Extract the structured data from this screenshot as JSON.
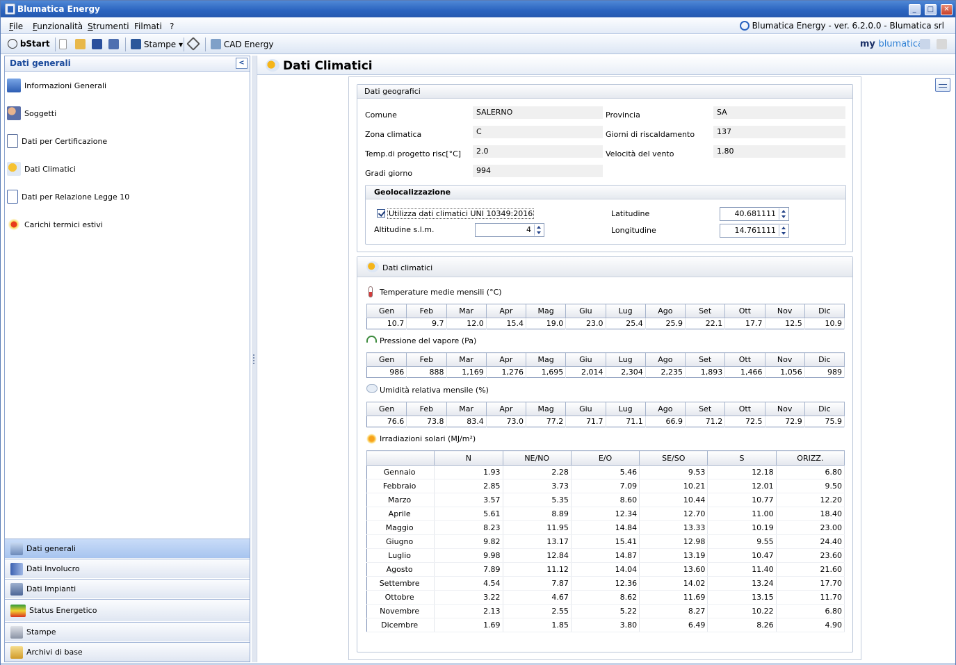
{
  "window": {
    "title": "Blumatica Energy"
  },
  "menu": {
    "items": [
      {
        "label": "File",
        "u": "F",
        "rest": "ile"
      },
      {
        "label": "Funzionalità",
        "u": "F",
        "rest": "unzionalità"
      },
      {
        "label": "Strumenti",
        "u": "S",
        "rest": "trumenti"
      },
      {
        "label": "Filmati",
        "u": "",
        "rest": "Filmati"
      },
      {
        "label": "?",
        "u": "",
        "rest": "?"
      }
    ],
    "version": "Blumatica Energy - ver. 6.2.0.0 - Blumatica srl"
  },
  "toolbar": {
    "bstart": "bStart",
    "stampe": "Stampe",
    "cad": "CAD Energy",
    "brand_my": "my",
    "brand_name": "blumatica"
  },
  "left": {
    "header": "Dati generali",
    "items": [
      {
        "label": "Informazioni Generali",
        "icon": "building-icon"
      },
      {
        "label": "Soggetti",
        "icon": "people-icon"
      },
      {
        "label": "Dati per Certificazione",
        "icon": "document-icon"
      },
      {
        "label": "Dati Climatici",
        "icon": "weather-icon"
      },
      {
        "label": "Dati per Relazione Legge 10",
        "icon": "report-icon"
      },
      {
        "label": "Carichi termici estivi",
        "icon": "thermometer-icon"
      }
    ],
    "tabs": [
      {
        "label": "Dati generali",
        "selected": true
      },
      {
        "label": "Dati Involucro"
      },
      {
        "label": "Dati Impianti"
      },
      {
        "label": "Status Energetico"
      },
      {
        "label": "Stampe"
      },
      {
        "label": "Archivi di base"
      }
    ]
  },
  "main": {
    "title": "Dati Climatici",
    "geo": {
      "header": "Dati geografici",
      "comune_label": "Comune",
      "comune": "SALERNO",
      "provincia_label": "Provincia",
      "provincia": "SA",
      "zona_label": "Zona climatica",
      "zona": "C",
      "giorni_label": "Giorni di riscaldamento",
      "giorni": "137",
      "temp_label": "Temp.di progetto risc[°C]",
      "temp": "2.0",
      "vento_label": "Velocità del vento",
      "vento": "1.80",
      "gradi_label": "Gradi giorno",
      "gradi": "994",
      "geoloc_header": "Geolocalizzazione",
      "uni_label": "Utilizza dati climatici UNI 10349:2016",
      "alt_label": "Altitudine s.l.m.",
      "alt": "4",
      "lat_label": "Latitudine",
      "lat": "40.681111",
      "lon_label": "Longitudine",
      "lon": "14.761111"
    },
    "clim": {
      "header": "Dati climatici",
      "months": [
        "Gen",
        "Feb",
        "Mar",
        "Apr",
        "Mag",
        "Giu",
        "Lug",
        "Ago",
        "Set",
        "Ott",
        "Nov",
        "Dic"
      ],
      "temp_label": "Temperature medie mensili (°C)",
      "temp": [
        "10.7",
        "9.7",
        "12.0",
        "15.4",
        "19.0",
        "23.0",
        "25.4",
        "25.9",
        "22.1",
        "17.7",
        "12.5",
        "10.9"
      ],
      "press_label": "Pressione del vapore (Pa)",
      "press": [
        "986",
        "888",
        "1,169",
        "1,276",
        "1,695",
        "2,014",
        "2,304",
        "2,235",
        "1,893",
        "1,466",
        "1,056",
        "989"
      ],
      "umid_label": "Umidità relativa mensile (%)",
      "umid": [
        "76.6",
        "73.8",
        "83.4",
        "73.0",
        "77.2",
        "71.7",
        "71.1",
        "66.9",
        "71.2",
        "72.5",
        "72.9",
        "75.9"
      ],
      "irr_label": "Irradiazioni solari (MJ/m²)",
      "irr_cols": [
        "",
        "N",
        "NE/NO",
        "E/O",
        "SE/SO",
        "S",
        "ORIZZ."
      ],
      "irr_rows": [
        [
          "Gennaio",
          "1.93",
          "2.28",
          "5.46",
          "9.53",
          "12.18",
          "6.80"
        ],
        [
          "Febbraio",
          "2.85",
          "3.73",
          "7.09",
          "10.21",
          "12.01",
          "9.50"
        ],
        [
          "Marzo",
          "3.57",
          "5.35",
          "8.60",
          "10.44",
          "10.77",
          "12.20"
        ],
        [
          "Aprile",
          "5.61",
          "8.89",
          "12.34",
          "12.70",
          "11.00",
          "18.40"
        ],
        [
          "Maggio",
          "8.23",
          "11.95",
          "14.84",
          "13.33",
          "10.19",
          "23.00"
        ],
        [
          "Giugno",
          "9.82",
          "13.17",
          "15.41",
          "12.98",
          "9.55",
          "24.40"
        ],
        [
          "Luglio",
          "9.98",
          "12.84",
          "14.87",
          "13.19",
          "10.47",
          "23.60"
        ],
        [
          "Agosto",
          "7.89",
          "11.12",
          "14.04",
          "13.60",
          "11.40",
          "21.60"
        ],
        [
          "Settembre",
          "4.54",
          "7.87",
          "12.36",
          "14.02",
          "13.24",
          "17.70"
        ],
        [
          "Ottobre",
          "3.22",
          "4.67",
          "8.62",
          "11.69",
          "13.15",
          "11.70"
        ],
        [
          "Novembre",
          "2.13",
          "2.55",
          "5.22",
          "8.27",
          "10.22",
          "6.80"
        ],
        [
          "Dicembre",
          "1.69",
          "1.85",
          "3.80",
          "6.49",
          "8.26",
          "4.90"
        ]
      ]
    }
  }
}
